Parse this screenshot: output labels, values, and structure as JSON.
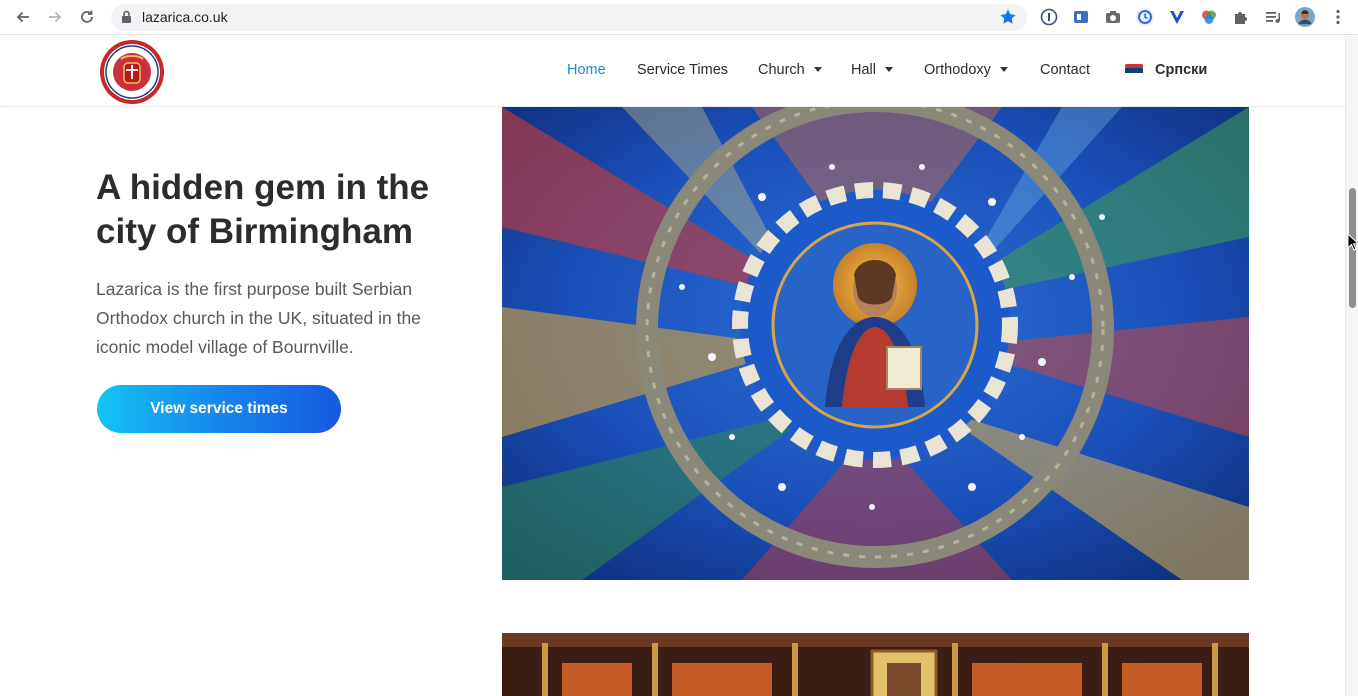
{
  "browser": {
    "url": "lazarica.co.uk",
    "back_icon": "back-arrow-icon",
    "forward_icon": "forward-arrow-icon",
    "reload_icon": "reload-icon",
    "extensions": [
      "1password-icon",
      "reader-icon",
      "camera-icon",
      "clock-extension-icon",
      "v-extension-icon",
      "color-wheel-icon",
      "puzzle-icon",
      "playlist-icon",
      "profile-avatar",
      "more-vert-icon"
    ]
  },
  "site": {
    "logo_alt": "Lazarica church seal",
    "nav": {
      "home": "Home",
      "service_times": "Service Times",
      "church": "Church",
      "hall": "Hall",
      "orthodoxy": "Orthodoxy",
      "contact": "Contact",
      "language": "Српски"
    },
    "colors": {
      "accent": "#1e8ad6",
      "cta_start": "#14c3f3",
      "cta_end": "#1658e0"
    }
  },
  "hero": {
    "title": "A hidden gem in the city of Birmingham",
    "text": "Lazarica is the first purpose built Serbian Orthodox church in the UK, situated in the iconic model village of Bournville.",
    "cta_label": "View service times"
  }
}
